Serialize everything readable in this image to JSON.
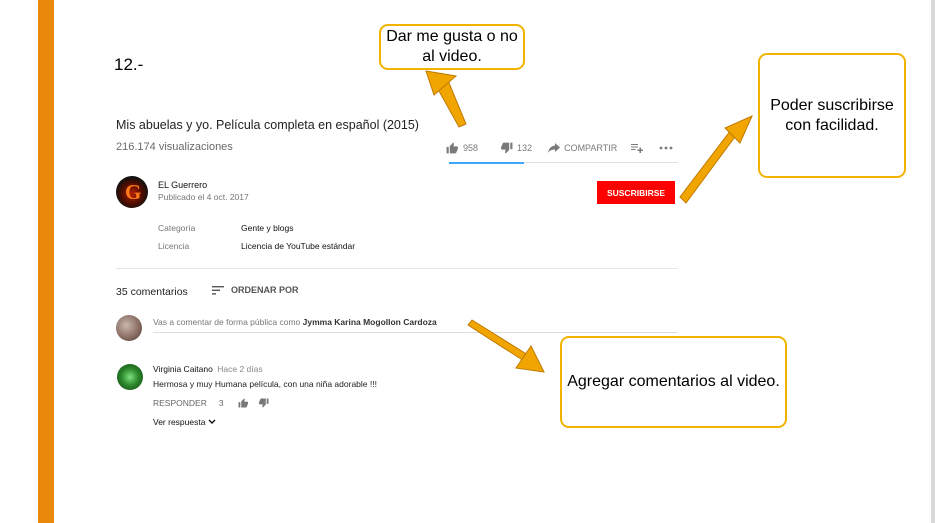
{
  "slide": {
    "number_label": "12.-"
  },
  "video": {
    "title": "Mis abuelas y yo. Película completa en español (2015)",
    "views": "216.174 visualizaciones",
    "likes": "958",
    "dislikes": "132",
    "share_label": "COMPARTIR"
  },
  "channel": {
    "name": "EL Guerrero",
    "published": "Publicado el 4 oct. 2017",
    "subscribe_label": "SUSCRIBIRSE",
    "avatar_letter": "G"
  },
  "metadata": [
    {
      "key": "Categoría",
      "value": "Gente y blogs"
    },
    {
      "key": "Licencia",
      "value": "Licencia de YouTube estándar"
    }
  ],
  "comments": {
    "count_label": "35 comentarios",
    "sort_label": "ORDENAR POR",
    "add_prompt": "Vas a comentar de forma pública como",
    "add_user": "Jymma Karina Mogollon Cardoza",
    "items": [
      {
        "author": "Virginia Caitano",
        "time": "Hace 2 días",
        "text": "Hermosa y  muy Humana película, con una niña adorable !!!",
        "reply_label": "RESPONDER",
        "likes": "3",
        "view_replies": "Ver respuesta"
      }
    ]
  },
  "callouts": {
    "like": "Dar me gusta o no al video.",
    "subscribe": "Poder suscribirse con facilidad.",
    "comment": "Agregar comentarios al video."
  },
  "colors": {
    "accent_bar": "#e8890c",
    "callout_border": "#f2b300",
    "subscribe_red": "#ff0000",
    "arrow": "#f0a500"
  }
}
